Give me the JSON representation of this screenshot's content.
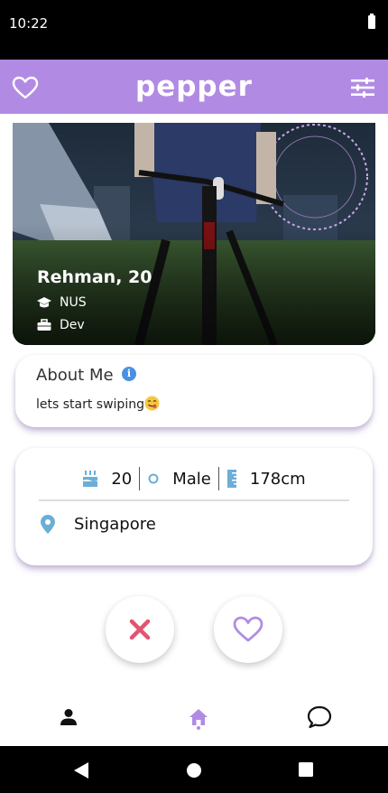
{
  "status_bar": {
    "time": "10:22"
  },
  "app_bar": {
    "logo": "pepper",
    "icons": [
      "heart-outline-icon",
      "filter-sliders-icon"
    ]
  },
  "profile": {
    "name_age": "Rehman, 20",
    "school": "NUS",
    "job": "Dev"
  },
  "about": {
    "title": "About Me",
    "text": "lets start swiping",
    "emoji": "yum-face-emoji"
  },
  "stats": {
    "age": "20",
    "gender": "Male",
    "height": "178cm",
    "location": "Singapore"
  },
  "actions": {
    "dislike_icon": "close-x-icon",
    "like_icon": "heart-outline-icon"
  },
  "bottom_nav": {
    "items": [
      "profile-icon",
      "home-icon",
      "chat-icon"
    ],
    "active": "home"
  },
  "colors": {
    "accent": "#b18be3",
    "dislike": "#e25472",
    "stat_icon": "#6baed6",
    "like": "#b18be3"
  }
}
